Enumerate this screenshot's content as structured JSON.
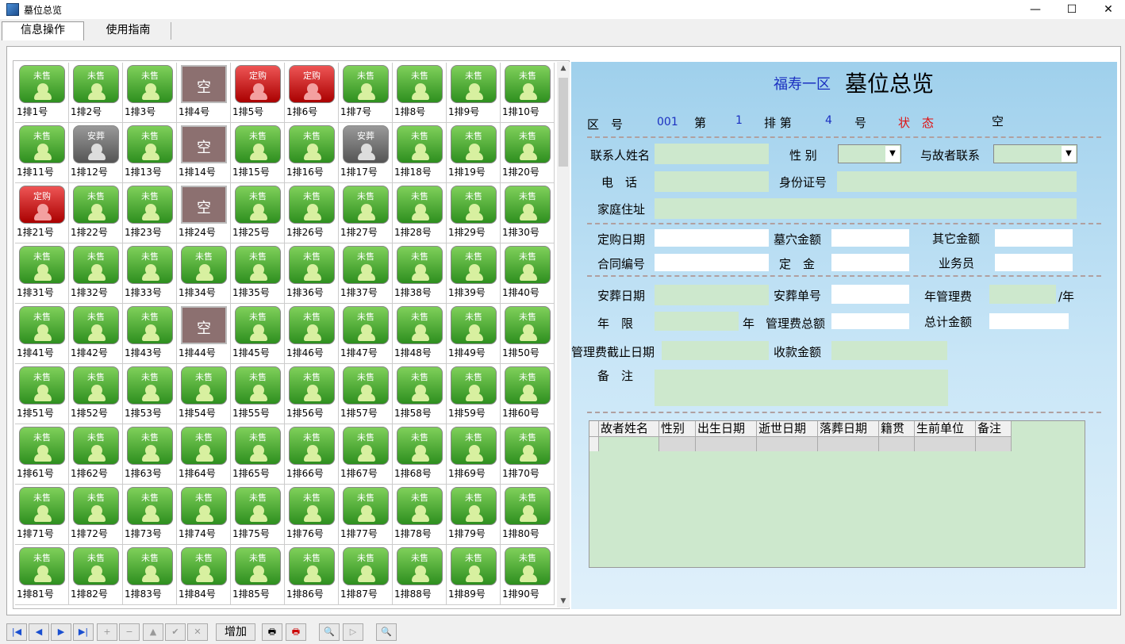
{
  "window": {
    "title": "墓位总览",
    "minimize": "—",
    "maximize": "☐",
    "close": "✕"
  },
  "tabs": [
    {
      "label": "信息操作"
    },
    {
      "label": "使用指南"
    }
  ],
  "grid": {
    "columns": 10,
    "cells": [
      {
        "status": "未售",
        "label": "1排1号"
      },
      {
        "status": "未售",
        "label": "1排2号"
      },
      {
        "status": "未售",
        "label": "1排3号"
      },
      {
        "status": "空",
        "label": "1排4号"
      },
      {
        "status": "定购",
        "label": "1排5号"
      },
      {
        "status": "定购",
        "label": "1排6号"
      },
      {
        "status": "未售",
        "label": "1排7号"
      },
      {
        "status": "未售",
        "label": "1排8号"
      },
      {
        "status": "未售",
        "label": "1排9号"
      },
      {
        "status": "未售",
        "label": "1排10号"
      },
      {
        "status": "未售",
        "label": "1排11号"
      },
      {
        "status": "安葬",
        "label": "1排12号"
      },
      {
        "status": "未售",
        "label": "1排13号"
      },
      {
        "status": "空",
        "label": "1排14号"
      },
      {
        "status": "未售",
        "label": "1排15号"
      },
      {
        "status": "未售",
        "label": "1排16号"
      },
      {
        "status": "安葬",
        "label": "1排17号"
      },
      {
        "status": "未售",
        "label": "1排18号"
      },
      {
        "status": "未售",
        "label": "1排19号"
      },
      {
        "status": "未售",
        "label": "1排20号"
      },
      {
        "status": "定购",
        "label": "1排21号"
      },
      {
        "status": "未售",
        "label": "1排22号"
      },
      {
        "status": "未售",
        "label": "1排23号"
      },
      {
        "status": "空",
        "label": "1排24号"
      },
      {
        "status": "未售",
        "label": "1排25号"
      },
      {
        "status": "未售",
        "label": "1排26号"
      },
      {
        "status": "未售",
        "label": "1排27号"
      },
      {
        "status": "未售",
        "label": "1排28号"
      },
      {
        "status": "未售",
        "label": "1排29号"
      },
      {
        "status": "未售",
        "label": "1排30号"
      },
      {
        "status": "未售",
        "label": "1排31号"
      },
      {
        "status": "未售",
        "label": "1排32号"
      },
      {
        "status": "未售",
        "label": "1排33号"
      },
      {
        "status": "未售",
        "label": "1排34号"
      },
      {
        "status": "未售",
        "label": "1排35号"
      },
      {
        "status": "未售",
        "label": "1排36号"
      },
      {
        "status": "未售",
        "label": "1排37号"
      },
      {
        "status": "未售",
        "label": "1排38号"
      },
      {
        "status": "未售",
        "label": "1排39号"
      },
      {
        "status": "未售",
        "label": "1排40号"
      },
      {
        "status": "未售",
        "label": "1排41号"
      },
      {
        "status": "未售",
        "label": "1排42号"
      },
      {
        "status": "未售",
        "label": "1排43号"
      },
      {
        "status": "空",
        "label": "1排44号"
      },
      {
        "status": "未售",
        "label": "1排45号"
      },
      {
        "status": "未售",
        "label": "1排46号"
      },
      {
        "status": "未售",
        "label": "1排47号"
      },
      {
        "status": "未售",
        "label": "1排48号"
      },
      {
        "status": "未售",
        "label": "1排49号"
      },
      {
        "status": "未售",
        "label": "1排50号"
      },
      {
        "status": "未售",
        "label": "1排51号"
      },
      {
        "status": "未售",
        "label": "1排52号"
      },
      {
        "status": "未售",
        "label": "1排53号"
      },
      {
        "status": "未售",
        "label": "1排54号"
      },
      {
        "status": "未售",
        "label": "1排55号"
      },
      {
        "status": "未售",
        "label": "1排56号"
      },
      {
        "status": "未售",
        "label": "1排57号"
      },
      {
        "status": "未售",
        "label": "1排58号"
      },
      {
        "status": "未售",
        "label": "1排59号"
      },
      {
        "status": "未售",
        "label": "1排60号"
      },
      {
        "status": "未售",
        "label": "1排61号"
      },
      {
        "status": "未售",
        "label": "1排62号"
      },
      {
        "status": "未售",
        "label": "1排63号"
      },
      {
        "status": "未售",
        "label": "1排64号"
      },
      {
        "status": "未售",
        "label": "1排65号"
      },
      {
        "status": "未售",
        "label": "1排66号"
      },
      {
        "status": "未售",
        "label": "1排67号"
      },
      {
        "status": "未售",
        "label": "1排68号"
      },
      {
        "status": "未售",
        "label": "1排69号"
      },
      {
        "status": "未售",
        "label": "1排70号"
      },
      {
        "status": "未售",
        "label": "1排71号"
      },
      {
        "status": "未售",
        "label": "1排72号"
      },
      {
        "status": "未售",
        "label": "1排73号"
      },
      {
        "status": "未售",
        "label": "1排74号"
      },
      {
        "status": "未售",
        "label": "1排75号"
      },
      {
        "status": "未售",
        "label": "1排76号"
      },
      {
        "status": "未售",
        "label": "1排77号"
      },
      {
        "status": "未售",
        "label": "1排78号"
      },
      {
        "status": "未售",
        "label": "1排79号"
      },
      {
        "status": "未售",
        "label": "1排80号"
      },
      {
        "status": "未售",
        "label": "1排81号"
      },
      {
        "status": "未售",
        "label": "1排82号"
      },
      {
        "status": "未售",
        "label": "1排83号"
      },
      {
        "status": "未售",
        "label": "1排84号"
      },
      {
        "status": "未售",
        "label": "1排85号"
      },
      {
        "status": "未售",
        "label": "1排86号"
      },
      {
        "status": "未售",
        "label": "1排87号"
      },
      {
        "status": "未售",
        "label": "1排88号"
      },
      {
        "status": "未售",
        "label": "1排89号"
      },
      {
        "status": "未售",
        "label": "1排90号"
      }
    ]
  },
  "scrollbar": {
    "up": "▲",
    "down": "▼"
  },
  "panel": {
    "area_name": "福寿一区",
    "title": "墓位总览",
    "zone_label": "区　号",
    "zone_value": "001",
    "row_prefix": "第",
    "row_value": "1",
    "row_suffix": "排 第",
    "num_value": "4",
    "num_suffix": "号",
    "status_label": "状　态",
    "status_value": "空",
    "contact_name": "联系人姓名",
    "gender": "性 别",
    "relation": "与故者联系",
    "phone": "电　话",
    "id_card": "身份证号",
    "address": "家庭住址",
    "order_date": "定购日期",
    "tomb_amount": "墓穴金额",
    "other_amount": "其它金额",
    "contract_no": "合同编号",
    "deposit": "定　金",
    "salesman": "业务员",
    "burial_date": "安葬日期",
    "burial_no": "安葬单号",
    "annual_fee": "年管理费",
    "per_year": "/年",
    "years": "年　限",
    "year_unit": "年",
    "total_fee": "管理费总额",
    "total_amount": "总计金额",
    "fee_end_date": "管理费截止日期",
    "received": "收款金额",
    "remarks": "备　注",
    "table_headers": [
      "故者姓名",
      "性别",
      "出生日期",
      "逝世日期",
      "落葬日期",
      "籍贯",
      "生前单位",
      "备注"
    ]
  },
  "toolbar": {
    "first": "|◀",
    "prev": "◀",
    "next": "▶",
    "last": "▶|",
    "insert": "+",
    "delete": "−",
    "edit": "▲",
    "post": "✔",
    "cancel": "✕",
    "add_label": "增加",
    "print": "🖶",
    "print2": "🖶",
    "preview": "🔍",
    "play": "▷",
    "find": "🔍"
  }
}
